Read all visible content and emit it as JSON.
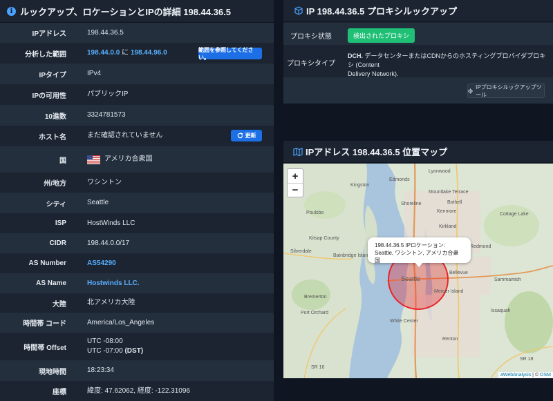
{
  "left_panel": {
    "title": "ルックアップ、ロケーションとIPの詳細 198.44.36.5",
    "rows": {
      "ip": {
        "label": "IPアドレス",
        "value": "198.44.36.5"
      },
      "range": {
        "label": "分析した範囲",
        "from": "198.44.0.0",
        "joiner": "に",
        "to": "198.44.96.0",
        "button": "範囲を参照してください。"
      },
      "type": {
        "label": "IPタイプ",
        "value": "IPv4"
      },
      "availability": {
        "label": "IPの可用性",
        "value": "パブリックIP"
      },
      "decimal": {
        "label": "10進数",
        "value": "3324781573"
      },
      "hostname": {
        "label": "ホスト名",
        "value": "まだ確認されていません",
        "button": "更新"
      },
      "country": {
        "label": "国",
        "value": "アメリカ合衆国"
      },
      "state": {
        "label": "州/地方",
        "value": "ワシントン"
      },
      "city": {
        "label": "シティ",
        "value": "Seattle"
      },
      "isp": {
        "label": "ISP",
        "value": "HostWinds LLC"
      },
      "cidr": {
        "label": "CIDR",
        "value": "198.44.0.0/17"
      },
      "asnum": {
        "label": "AS Number",
        "value": "AS54290"
      },
      "asname": {
        "label": "AS Name",
        "value": "Hostwinds LLC."
      },
      "continent": {
        "label": "大陸",
        "value": "北アメリカ大陸"
      },
      "timezone": {
        "label": "時間帯 コード",
        "value": "America/Los_Angeles"
      },
      "offset": {
        "label": "時間帯 Offset",
        "line1": "UTC -08:00",
        "line2": "UTC -07:00",
        "dst": "(DST)"
      },
      "localtime": {
        "label": "現地時間",
        "value": "18:23:34"
      },
      "coords": {
        "label": "座標",
        "value": "緯度: 47.62062, 経度: -122.31096"
      }
    }
  },
  "proxy_panel": {
    "title": "IP 198.44.36.5 プロキシルックアップ",
    "status_label": "プロキシ状態",
    "status_badge": "検出されたプロキシ",
    "type_label": "プロキシタイプ",
    "type_code": "DCH.",
    "type_desc_1": " データセンターまたはCDNからのホスティングプロバイダプロキシ (Content",
    "type_desc_2": "Delivery Network).",
    "tool_button": "IPプロキシルックアップツール"
  },
  "map_panel": {
    "title": "IPアドレス 198.44.36.5 位置マップ",
    "zoom_in": "+",
    "zoom_out": "−",
    "popup_line1": "198.44.36.5 IPロケーション:",
    "popup_line2": "Seattle, ワシントン, アメリカ合衆国",
    "attribution_link": "aWebAnalysis",
    "attribution_sep": " | © ",
    "attribution_osm": "OSM",
    "place_labels": [
      "Lynnwood",
      "Edmonds",
      "Kingston",
      "Mountlake Terrace",
      "Shoreline",
      "Bothell",
      "Poulsbo",
      "Kenmore",
      "Kirkland",
      "Cottage Lake",
      "Silverdale",
      "Bainbridge Island",
      "Kitsap County",
      "Redmond",
      "Seattle",
      "Bellevue",
      "Sammamish",
      "Bremerton",
      "Mercer Island",
      "Issaquah",
      "Port Orchard",
      "White Center",
      "Renton",
      "SR 16",
      "SR 18"
    ]
  },
  "colors": {
    "accent": "#4aa3ff",
    "link": "#5ab0ff",
    "button_blue": "#1d6fe6",
    "badge_green": "#1fbf75",
    "circle": "#e8242b"
  },
  "icons": {
    "info": "info-circle-icon",
    "cube": "cube-icon",
    "map": "map-icon",
    "refresh": "refresh-icon",
    "gear": "gear-icon",
    "flag": "us-flag-icon"
  }
}
